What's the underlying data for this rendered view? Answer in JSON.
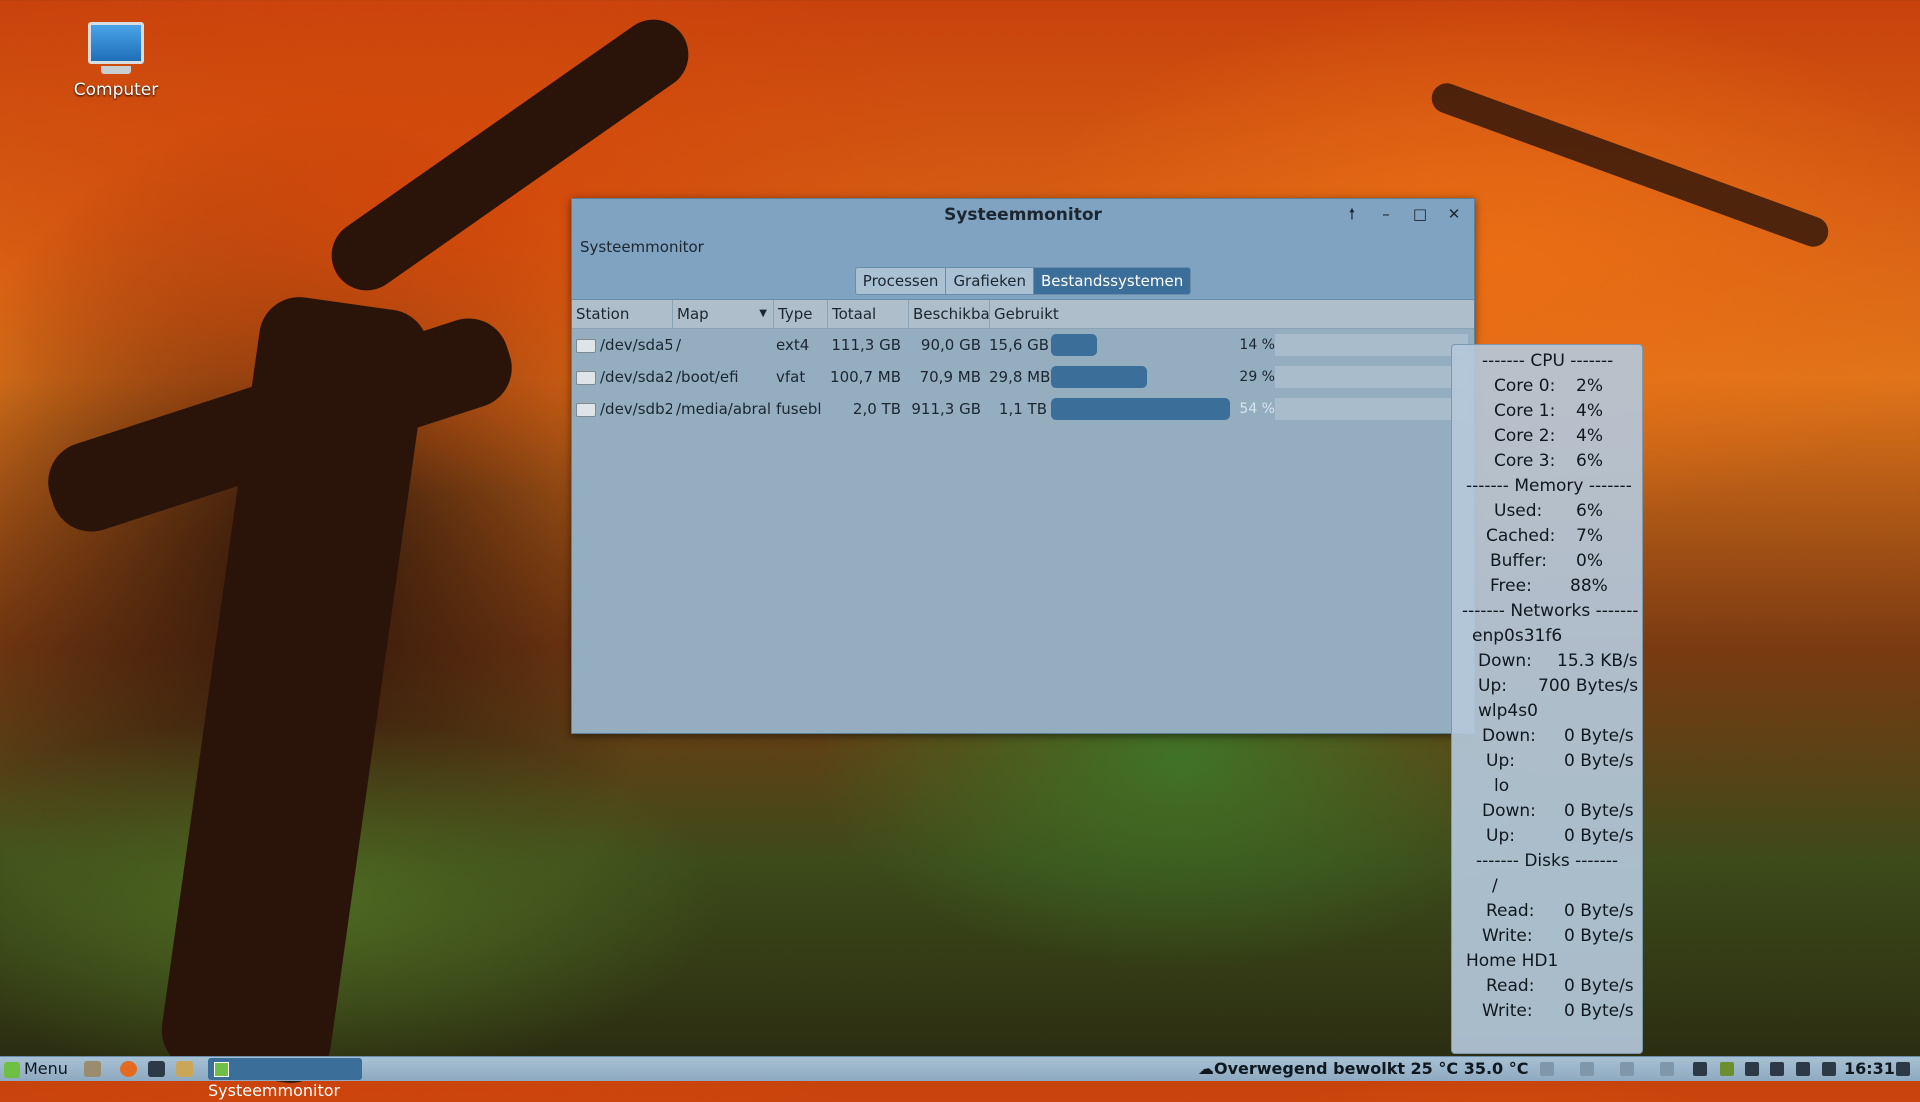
{
  "desktop": {
    "icon_label": "Computer"
  },
  "window": {
    "title": "Systeemmonitor",
    "menu_label": "Systeemmonitor",
    "controls": [
      "🠕",
      "–",
      "□",
      "✕"
    ],
    "tabs": [
      {
        "label": "Processen",
        "active": false
      },
      {
        "label": "Grafieken",
        "active": false
      },
      {
        "label": "Bestandssystemen",
        "active": true
      }
    ],
    "columns": [
      "Station",
      "Map",
      "Type",
      "Totaal",
      "Beschikba",
      "Gebruikt"
    ],
    "rows": [
      {
        "device": "/dev/sda5",
        "map": "/",
        "type": "ext4",
        "total": "111,3 GB",
        "available": "90,0 GB",
        "used": "15,6 GB",
        "usage_pct": 14,
        "usage_label": "14 %"
      },
      {
        "device": "/dev/sda2",
        "map": "/boot/efi",
        "type": "vfat",
        "total": "100,7 MB",
        "available": "70,9 MB",
        "used": "29,8 MB",
        "usage_pct": 29,
        "usage_label": "29 %"
      },
      {
        "device": "/dev/sdb2",
        "map": "/media/abral",
        "type": "fusebl",
        "total": "2,0 TB",
        "available": "911,3 GB",
        "used": "1,1 TB",
        "usage_pct": 54,
        "usage_label": "54 %"
      }
    ]
  },
  "conky": {
    "cpu_header": "------- CPU -------",
    "cores": [
      {
        "label": "Core 0:",
        "value": "2%"
      },
      {
        "label": "Core 1:",
        "value": "4%"
      },
      {
        "label": "Core 2:",
        "value": "4%"
      },
      {
        "label": "Core 3:",
        "value": "6%"
      }
    ],
    "memory_header": "------- Memory -------",
    "memory": [
      {
        "label": "Used:",
        "value": "6%"
      },
      {
        "label": "Cached:",
        "value": "7%"
      },
      {
        "label": "Buffer:",
        "value": "0%"
      },
      {
        "label": "Free:",
        "value": "88%"
      }
    ],
    "networks_header": "------- Networks -------",
    "networks": [
      {
        "name": "enp0s31f6",
        "down": "15.3 KB/s",
        "up": "700 Bytes/s"
      },
      {
        "name": "wlp4s0",
        "down": "0 Byte/s",
        "up": "0 Byte/s"
      },
      {
        "name": "lo",
        "down": "0 Byte/s",
        "up": "0 Byte/s"
      }
    ],
    "down_label": "Down:",
    "up_label": "Up:",
    "disks_header": "------- Disks -------",
    "disks": [
      {
        "name": "/",
        "read": "0 Byte/s",
        "write": "0 Byte/s"
      },
      {
        "name": "Home HD1",
        "read": "0 Byte/s",
        "write": "0 Byte/s"
      }
    ],
    "read_label": "Read:",
    "write_label": "Write:"
  },
  "taskbar": {
    "menu_label": "Menu",
    "task_label": "Systeemmonitor",
    "weather": "☁Overwegend bewolkt 25 °C 35.0 °C",
    "clock": "16:31"
  }
}
